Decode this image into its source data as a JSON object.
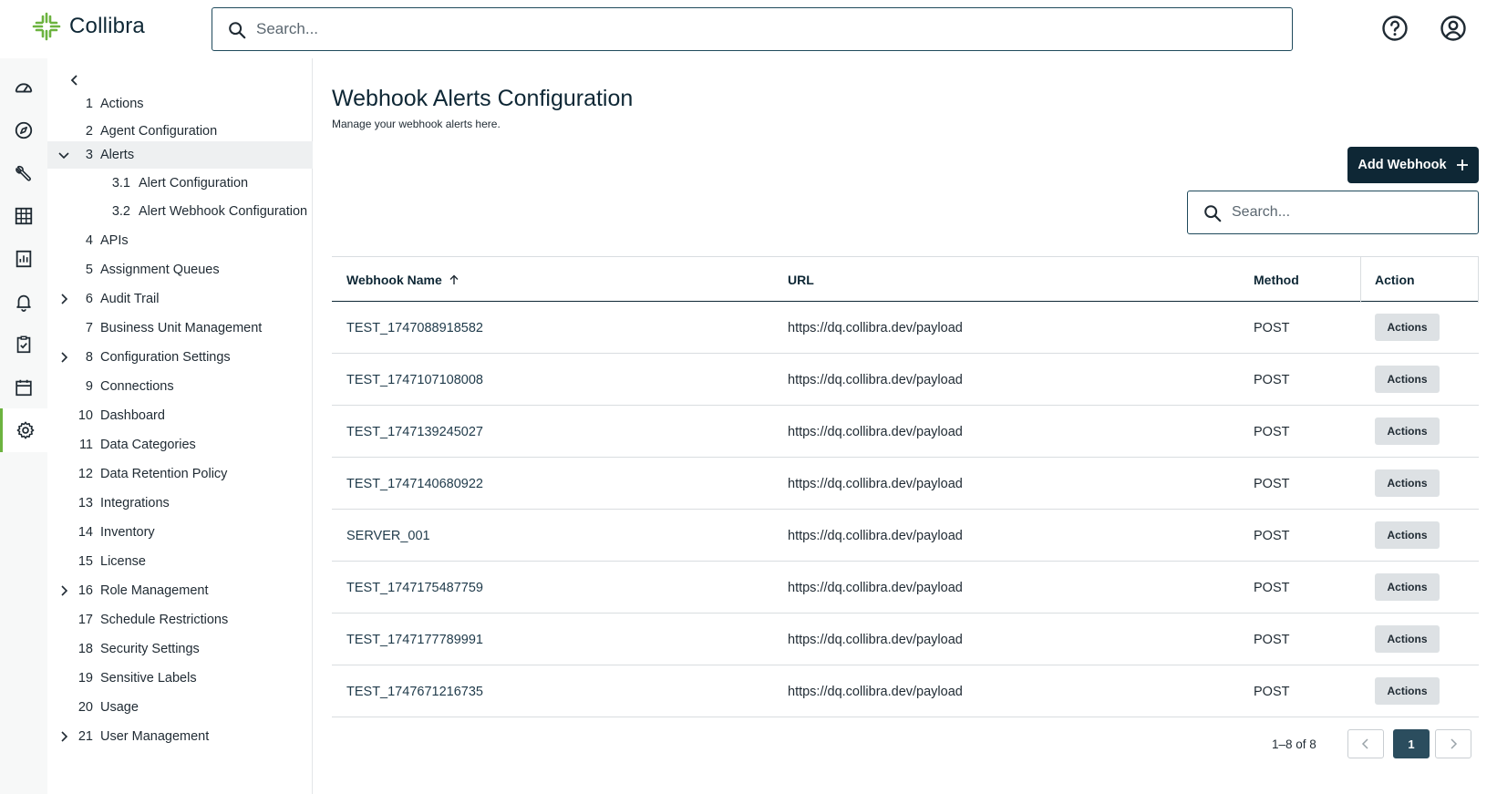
{
  "brand": {
    "name": "Collibra",
    "accent": "#6cb33f",
    "dark": "#0e2735"
  },
  "header": {
    "search_placeholder": "Search..."
  },
  "rail": [
    "dashboard-icon",
    "compass-icon",
    "wrench-icon",
    "table-grid-icon",
    "report-icon",
    "bell-icon",
    "clipboard-check-icon",
    "calendar-icon",
    "gear-icon"
  ],
  "tree": [
    {
      "num": "1",
      "label": "Actions"
    },
    {
      "num": "2",
      "label": "Agent Configuration"
    },
    {
      "num": "3",
      "label": "Alerts"
    },
    {
      "num": "3.1",
      "label": "Alert Configuration"
    },
    {
      "num": "3.2",
      "label": "Alert Webhook Configuration"
    },
    {
      "num": "4",
      "label": "APIs"
    },
    {
      "num": "5",
      "label": "Assignment Queues"
    },
    {
      "num": "6",
      "label": "Audit Trail"
    },
    {
      "num": "7",
      "label": "Business Unit Management"
    },
    {
      "num": "8",
      "label": "Configuration Settings"
    },
    {
      "num": "9",
      "label": "Connections"
    },
    {
      "num": "10",
      "label": "Dashboard"
    },
    {
      "num": "11",
      "label": "Data Categories"
    },
    {
      "num": "12",
      "label": "Data Retention Policy"
    },
    {
      "num": "13",
      "label": "Integrations"
    },
    {
      "num": "14",
      "label": "Inventory"
    },
    {
      "num": "15",
      "label": "License"
    },
    {
      "num": "16",
      "label": "Role Management"
    },
    {
      "num": "17",
      "label": "Schedule Restrictions"
    },
    {
      "num": "18",
      "label": "Security Settings"
    },
    {
      "num": "19",
      "label": "Sensitive Labels"
    },
    {
      "num": "20",
      "label": "Usage"
    },
    {
      "num": "21",
      "label": "User Management"
    }
  ],
  "page": {
    "title": "Webhook Alerts Configuration",
    "subtitle": "Manage your webhook alerts here.",
    "add_button": "Add Webhook",
    "search_placeholder": "Search..."
  },
  "table": {
    "headers": {
      "name": "Webhook Name",
      "url": "URL",
      "method": "Method",
      "action": "Action"
    },
    "rows": [
      {
        "name": "TEST_1747088918582",
        "url": "https://dq.collibra.dev/payload",
        "method": "POST",
        "action": "Actions"
      },
      {
        "name": "TEST_1747107108008",
        "url": "https://dq.collibra.dev/payload",
        "method": "POST",
        "action": "Actions"
      },
      {
        "name": "TEST_1747139245027",
        "url": "https://dq.collibra.dev/payload",
        "method": "POST",
        "action": "Actions"
      },
      {
        "name": "TEST_1747140680922",
        "url": "https://dq.collibra.dev/payload",
        "method": "POST",
        "action": "Actions"
      },
      {
        "name": "SERVER_001",
        "url": "https://dq.collibra.dev/payload",
        "method": "POST",
        "action": "Actions"
      },
      {
        "name": "TEST_1747175487759",
        "url": "https://dq.collibra.dev/payload",
        "method": "POST",
        "action": "Actions"
      },
      {
        "name": "TEST_1747177789991",
        "url": "https://dq.collibra.dev/payload",
        "method": "POST",
        "action": "Actions"
      },
      {
        "name": "TEST_1747671216735",
        "url": "https://dq.collibra.dev/payload",
        "method": "POST",
        "action": "Actions"
      }
    ]
  },
  "pagination": {
    "range": "1–8 of 8",
    "current_page": "1"
  }
}
